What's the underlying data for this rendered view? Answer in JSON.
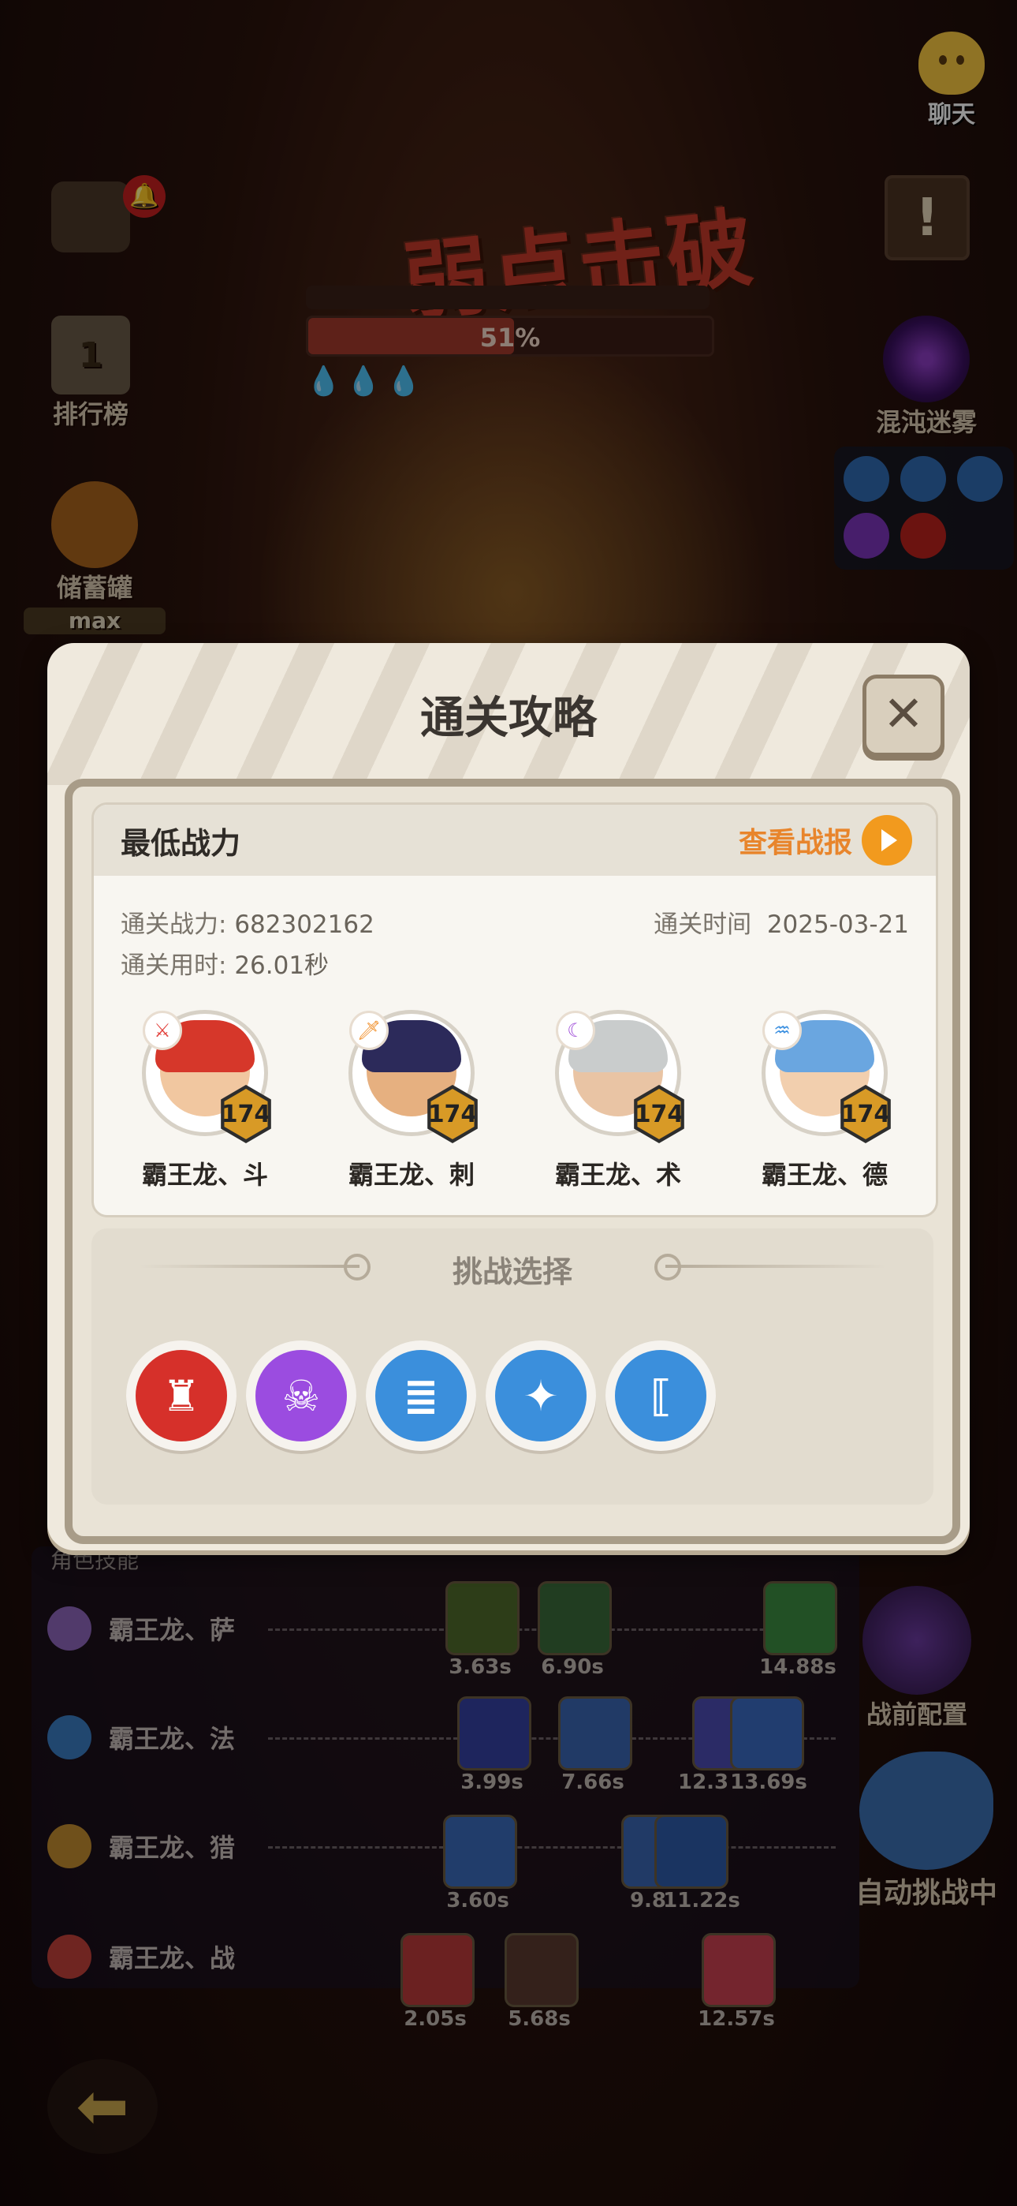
{
  "hud": {
    "chat_label": "聊天",
    "ranking_label": "排行榜",
    "rank_number": "1",
    "piggy_label": "储蓄罐",
    "piggy_status": "max",
    "chaos_label": "混沌迷雾",
    "prebattle_label": "战前配置",
    "auto_label": "自动挑战中"
  },
  "boss": {
    "banner": "弱点击破",
    "hp_percent_text": "51%",
    "hp_fraction": 0.51
  },
  "modal": {
    "title": "通关攻略",
    "close_glyph": "✕",
    "card_title": "最低战力",
    "replay_label": "查看战报",
    "power_label": "通关战力:",
    "power_value": "682302162",
    "time_label": "通关用时:",
    "time_value": "26.01秒",
    "date_label": "通关时间",
    "date_value": "2025-03-21",
    "heroes": [
      {
        "name": "霸王龙、斗",
        "level": "174",
        "badge": "⚔",
        "badge_color": "#e2413c",
        "hair": "#d6372a",
        "skin": "#f1c7a0"
      },
      {
        "name": "霸王龙、刺",
        "level": "174",
        "badge": "🗡",
        "badge_color": "#f08a20",
        "hair": "#2c2a5a",
        "skin": "#e6b080"
      },
      {
        "name": "霸王龙、术",
        "level": "174",
        "badge": "☾",
        "badge_color": "#a04fd8",
        "hair": "#c9cccc",
        "skin": "#e9c4a4"
      },
      {
        "name": "霸王龙、德",
        "level": "174",
        "badge": "♒",
        "badge_color": "#3a8fe0",
        "hair": "#6aa6e0",
        "skin": "#f2cfae"
      }
    ],
    "challenge_title": "挑战选择",
    "challenges": [
      {
        "icon": "red-monster-icon",
        "glyph": "♜",
        "color": "#d6302a"
      },
      {
        "icon": "purple-skull-icon",
        "glyph": "☠",
        "color": "#9b4ce0"
      },
      {
        "icon": "blue-speech-icon",
        "glyph": "≣",
        "color": "#3b8fdc"
      },
      {
        "icon": "blue-star-icon",
        "glyph": "✦",
        "color": "#3b8fdc"
      },
      {
        "icon": "blue-bracket-icon",
        "glyph": "⟦",
        "color": "#3b8fdc"
      }
    ]
  },
  "battle": {
    "panel_header": "角色技能",
    "rows": [
      {
        "name": "霸王龙、萨",
        "times": [
          "3.63s",
          "6.90s",
          "14.88s"
        ]
      },
      {
        "name": "霸王龙、法",
        "times": [
          "3.99s",
          "7.66s",
          "12.3",
          "13.69s"
        ]
      },
      {
        "name": "霸王龙、猎",
        "times": [
          "3.60s",
          "9.8",
          "11.22s"
        ]
      },
      {
        "name": "霸王龙、战",
        "times": [
          "2.05s",
          "5.68s",
          "12.57s"
        ]
      }
    ]
  },
  "colors": {
    "accent_orange": "#e8852c",
    "level_gold": "#d89a26",
    "hp_red": "#a33a2c"
  }
}
